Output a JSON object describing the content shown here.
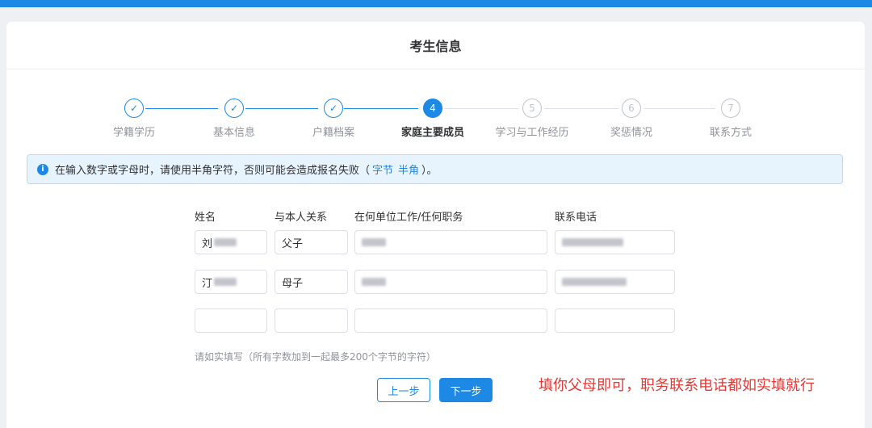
{
  "header": {
    "title": "考生信息"
  },
  "steps": [
    {
      "label": "学籍学历",
      "mark": "✓",
      "state": "done"
    },
    {
      "label": "基本信息",
      "mark": "✓",
      "state": "done"
    },
    {
      "label": "户籍档案",
      "mark": "✓",
      "state": "done"
    },
    {
      "label": "家庭主要成员",
      "mark": "4",
      "state": "active"
    },
    {
      "label": "学习与工作经历",
      "mark": "5",
      "state": "todo"
    },
    {
      "label": "奖惩情况",
      "mark": "6",
      "state": "todo"
    },
    {
      "label": "联系方式",
      "mark": "7",
      "state": "todo"
    }
  ],
  "alert": {
    "icon": "info-icon",
    "text_before": "在输入数字或字母时，请使用半角字符，否则可能会造成报名失败（",
    "link_1": "字节",
    "link_2": "半角",
    "text_after": "）。"
  },
  "form": {
    "headers": {
      "name": "姓名",
      "relation": "与本人关系",
      "work": "在何单位工作/任何职务",
      "phone": "联系电话"
    },
    "rows": [
      {
        "name_prefix": "刘",
        "relation": "父子"
      },
      {
        "name_prefix": "汀",
        "relation": "母子"
      },
      {
        "name_prefix": "",
        "relation": ""
      }
    ],
    "hint": "请如实填写（所有字数加到一起最多200个字节的字符）"
  },
  "buttons": {
    "prev": "上一步",
    "next": "下一步"
  },
  "annotation": "填你父母即可，职务联系电话都如实填就行",
  "colors": {
    "accent": "#1e88e5",
    "annotation": "#e53935"
  }
}
